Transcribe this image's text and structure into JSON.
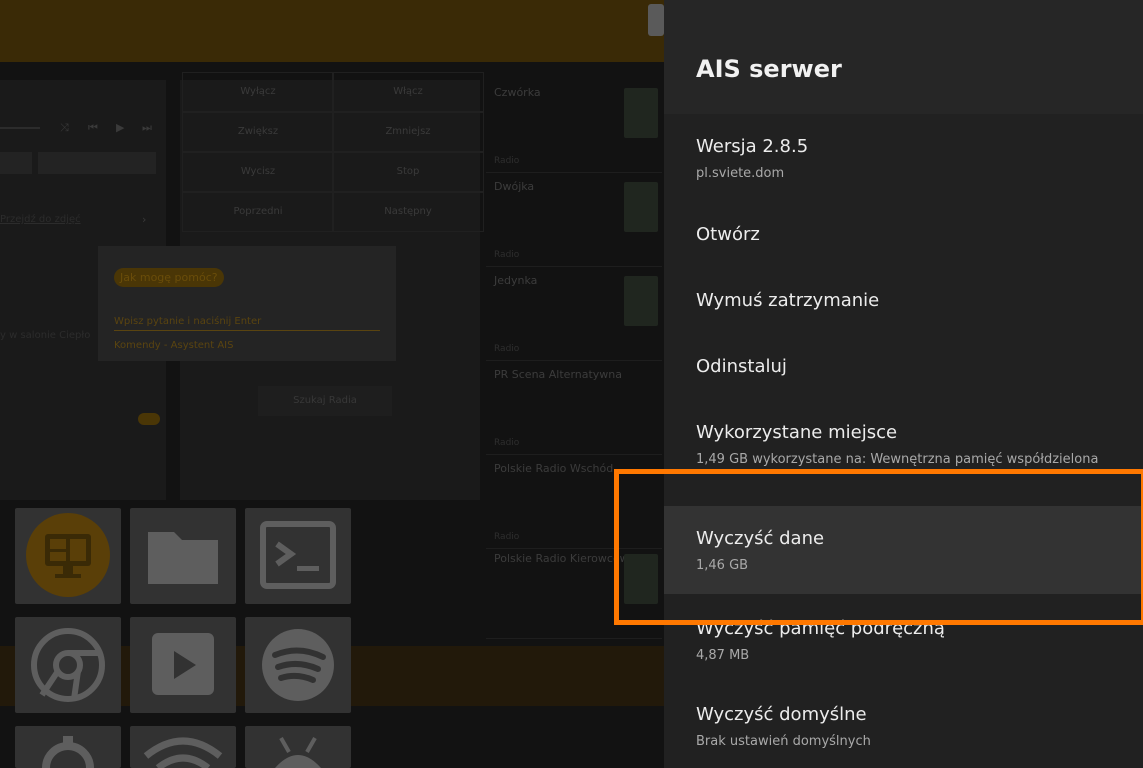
{
  "background": {
    "grid": [
      "Wyłącz",
      "Włącz",
      "Zwiększ",
      "Zmniejsz",
      "Wycisz",
      "Stop",
      "Poprzedni",
      "Następny"
    ],
    "radio": [
      {
        "title": "Czwórka",
        "sub": "Radio"
      },
      {
        "title": "Dwójka",
        "sub": "Radio"
      },
      {
        "title": "Jedynka",
        "sub": "Radio"
      },
      {
        "title": "PR Scena Alternatywna",
        "sub": "Radio"
      },
      {
        "title": "Polskie Radio Wschód",
        "sub": "Radio"
      },
      {
        "title": "Polskie Radio Kierowców",
        "sub": ""
      }
    ],
    "dialog": {
      "chip": "Jak mogę pomóc?",
      "input": "Wpisz pytanie i naciśnij  Enter",
      "link": "Komendy - Asystent AIS"
    },
    "left_link": "Przejdź do zdjęć",
    "left_note": "y w salonie Ciepło",
    "mid_button": "Szukaj Radia"
  },
  "panel": {
    "title": "AIS serwer",
    "items": [
      {
        "title": "Wersja 2.8.5",
        "sub": "pl.sviete.dom"
      },
      {
        "title": "Otwórz"
      },
      {
        "title": "Wymuś zatrzymanie"
      },
      {
        "title": "Odinstaluj"
      },
      {
        "title": "Wykorzystane miejsce",
        "sub": "1,49 GB wykorzystane na: Wewnętrzna pamięć współdzielona"
      },
      {
        "title": "Wyczyść dane",
        "sub": "1,46 GB"
      },
      {
        "title": "Wyczyść pamięć podręczną",
        "sub": "4,87 MB"
      },
      {
        "title": "Wyczyść domyślne",
        "sub": "Brak ustawień domyślnych"
      }
    ]
  },
  "colors": {
    "highlight": "#ff7800",
    "panel_bg": "#212121",
    "accent_dim": "#4a3606"
  }
}
